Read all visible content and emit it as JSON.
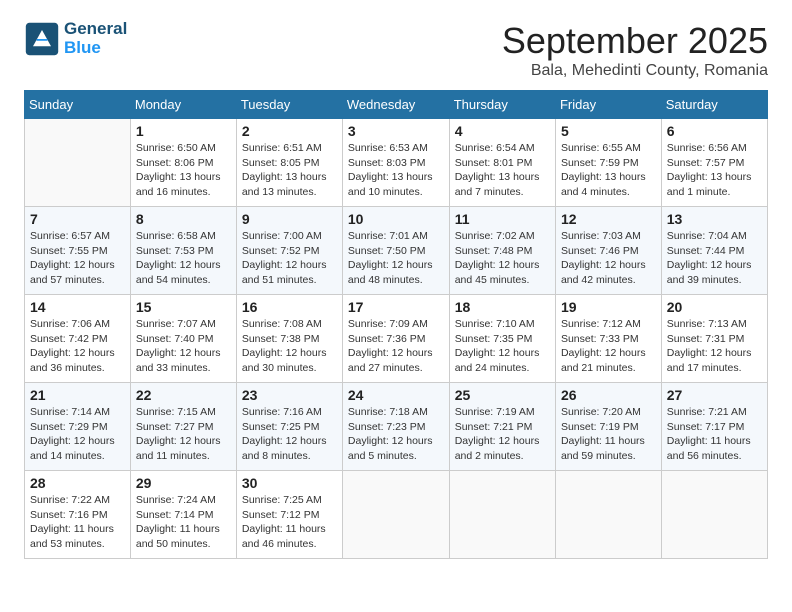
{
  "logo": {
    "general": "General",
    "blue": "Blue"
  },
  "title": {
    "month": "September 2025",
    "location": "Bala, Mehedinti County, Romania"
  },
  "weekdays": [
    "Sunday",
    "Monday",
    "Tuesday",
    "Wednesday",
    "Thursday",
    "Friday",
    "Saturday"
  ],
  "weeks": [
    [
      {
        "day": "",
        "info": ""
      },
      {
        "day": "1",
        "info": "Sunrise: 6:50 AM\nSunset: 8:06 PM\nDaylight: 13 hours\nand 16 minutes."
      },
      {
        "day": "2",
        "info": "Sunrise: 6:51 AM\nSunset: 8:05 PM\nDaylight: 13 hours\nand 13 minutes."
      },
      {
        "day": "3",
        "info": "Sunrise: 6:53 AM\nSunset: 8:03 PM\nDaylight: 13 hours\nand 10 minutes."
      },
      {
        "day": "4",
        "info": "Sunrise: 6:54 AM\nSunset: 8:01 PM\nDaylight: 13 hours\nand 7 minutes."
      },
      {
        "day": "5",
        "info": "Sunrise: 6:55 AM\nSunset: 7:59 PM\nDaylight: 13 hours\nand 4 minutes."
      },
      {
        "day": "6",
        "info": "Sunrise: 6:56 AM\nSunset: 7:57 PM\nDaylight: 13 hours\nand 1 minute."
      }
    ],
    [
      {
        "day": "7",
        "info": "Sunrise: 6:57 AM\nSunset: 7:55 PM\nDaylight: 12 hours\nand 57 minutes."
      },
      {
        "day": "8",
        "info": "Sunrise: 6:58 AM\nSunset: 7:53 PM\nDaylight: 12 hours\nand 54 minutes."
      },
      {
        "day": "9",
        "info": "Sunrise: 7:00 AM\nSunset: 7:52 PM\nDaylight: 12 hours\nand 51 minutes."
      },
      {
        "day": "10",
        "info": "Sunrise: 7:01 AM\nSunset: 7:50 PM\nDaylight: 12 hours\nand 48 minutes."
      },
      {
        "day": "11",
        "info": "Sunrise: 7:02 AM\nSunset: 7:48 PM\nDaylight: 12 hours\nand 45 minutes."
      },
      {
        "day": "12",
        "info": "Sunrise: 7:03 AM\nSunset: 7:46 PM\nDaylight: 12 hours\nand 42 minutes."
      },
      {
        "day": "13",
        "info": "Sunrise: 7:04 AM\nSunset: 7:44 PM\nDaylight: 12 hours\nand 39 minutes."
      }
    ],
    [
      {
        "day": "14",
        "info": "Sunrise: 7:06 AM\nSunset: 7:42 PM\nDaylight: 12 hours\nand 36 minutes."
      },
      {
        "day": "15",
        "info": "Sunrise: 7:07 AM\nSunset: 7:40 PM\nDaylight: 12 hours\nand 33 minutes."
      },
      {
        "day": "16",
        "info": "Sunrise: 7:08 AM\nSunset: 7:38 PM\nDaylight: 12 hours\nand 30 minutes."
      },
      {
        "day": "17",
        "info": "Sunrise: 7:09 AM\nSunset: 7:36 PM\nDaylight: 12 hours\nand 27 minutes."
      },
      {
        "day": "18",
        "info": "Sunrise: 7:10 AM\nSunset: 7:35 PM\nDaylight: 12 hours\nand 24 minutes."
      },
      {
        "day": "19",
        "info": "Sunrise: 7:12 AM\nSunset: 7:33 PM\nDaylight: 12 hours\nand 21 minutes."
      },
      {
        "day": "20",
        "info": "Sunrise: 7:13 AM\nSunset: 7:31 PM\nDaylight: 12 hours\nand 17 minutes."
      }
    ],
    [
      {
        "day": "21",
        "info": "Sunrise: 7:14 AM\nSunset: 7:29 PM\nDaylight: 12 hours\nand 14 minutes."
      },
      {
        "day": "22",
        "info": "Sunrise: 7:15 AM\nSunset: 7:27 PM\nDaylight: 12 hours\nand 11 minutes."
      },
      {
        "day": "23",
        "info": "Sunrise: 7:16 AM\nSunset: 7:25 PM\nDaylight: 12 hours\nand 8 minutes."
      },
      {
        "day": "24",
        "info": "Sunrise: 7:18 AM\nSunset: 7:23 PM\nDaylight: 12 hours\nand 5 minutes."
      },
      {
        "day": "25",
        "info": "Sunrise: 7:19 AM\nSunset: 7:21 PM\nDaylight: 12 hours\nand 2 minutes."
      },
      {
        "day": "26",
        "info": "Sunrise: 7:20 AM\nSunset: 7:19 PM\nDaylight: 11 hours\nand 59 minutes."
      },
      {
        "day": "27",
        "info": "Sunrise: 7:21 AM\nSunset: 7:17 PM\nDaylight: 11 hours\nand 56 minutes."
      }
    ],
    [
      {
        "day": "28",
        "info": "Sunrise: 7:22 AM\nSunset: 7:16 PM\nDaylight: 11 hours\nand 53 minutes."
      },
      {
        "day": "29",
        "info": "Sunrise: 7:24 AM\nSunset: 7:14 PM\nDaylight: 11 hours\nand 50 minutes."
      },
      {
        "day": "30",
        "info": "Sunrise: 7:25 AM\nSunset: 7:12 PM\nDaylight: 11 hours\nand 46 minutes."
      },
      {
        "day": "",
        "info": ""
      },
      {
        "day": "",
        "info": ""
      },
      {
        "day": "",
        "info": ""
      },
      {
        "day": "",
        "info": ""
      }
    ]
  ]
}
